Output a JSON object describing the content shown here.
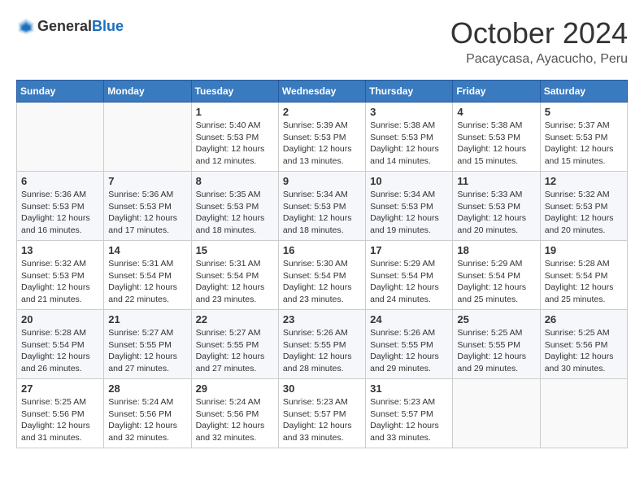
{
  "header": {
    "logo": {
      "general": "General",
      "blue": "Blue"
    },
    "month": "October 2024",
    "location": "Pacaycasa, Ayacucho, Peru"
  },
  "days_of_week": [
    "Sunday",
    "Monday",
    "Tuesday",
    "Wednesday",
    "Thursday",
    "Friday",
    "Saturday"
  ],
  "weeks": [
    [
      {
        "day": "",
        "info": ""
      },
      {
        "day": "",
        "info": ""
      },
      {
        "day": "1",
        "info": "Sunrise: 5:40 AM\nSunset: 5:53 PM\nDaylight: 12 hours and 12 minutes."
      },
      {
        "day": "2",
        "info": "Sunrise: 5:39 AM\nSunset: 5:53 PM\nDaylight: 12 hours and 13 minutes."
      },
      {
        "day": "3",
        "info": "Sunrise: 5:38 AM\nSunset: 5:53 PM\nDaylight: 12 hours and 14 minutes."
      },
      {
        "day": "4",
        "info": "Sunrise: 5:38 AM\nSunset: 5:53 PM\nDaylight: 12 hours and 15 minutes."
      },
      {
        "day": "5",
        "info": "Sunrise: 5:37 AM\nSunset: 5:53 PM\nDaylight: 12 hours and 15 minutes."
      }
    ],
    [
      {
        "day": "6",
        "info": "Sunrise: 5:36 AM\nSunset: 5:53 PM\nDaylight: 12 hours and 16 minutes."
      },
      {
        "day": "7",
        "info": "Sunrise: 5:36 AM\nSunset: 5:53 PM\nDaylight: 12 hours and 17 minutes."
      },
      {
        "day": "8",
        "info": "Sunrise: 5:35 AM\nSunset: 5:53 PM\nDaylight: 12 hours and 18 minutes."
      },
      {
        "day": "9",
        "info": "Sunrise: 5:34 AM\nSunset: 5:53 PM\nDaylight: 12 hours and 18 minutes."
      },
      {
        "day": "10",
        "info": "Sunrise: 5:34 AM\nSunset: 5:53 PM\nDaylight: 12 hours and 19 minutes."
      },
      {
        "day": "11",
        "info": "Sunrise: 5:33 AM\nSunset: 5:53 PM\nDaylight: 12 hours and 20 minutes."
      },
      {
        "day": "12",
        "info": "Sunrise: 5:32 AM\nSunset: 5:53 PM\nDaylight: 12 hours and 20 minutes."
      }
    ],
    [
      {
        "day": "13",
        "info": "Sunrise: 5:32 AM\nSunset: 5:53 PM\nDaylight: 12 hours and 21 minutes."
      },
      {
        "day": "14",
        "info": "Sunrise: 5:31 AM\nSunset: 5:54 PM\nDaylight: 12 hours and 22 minutes."
      },
      {
        "day": "15",
        "info": "Sunrise: 5:31 AM\nSunset: 5:54 PM\nDaylight: 12 hours and 23 minutes."
      },
      {
        "day": "16",
        "info": "Sunrise: 5:30 AM\nSunset: 5:54 PM\nDaylight: 12 hours and 23 minutes."
      },
      {
        "day": "17",
        "info": "Sunrise: 5:29 AM\nSunset: 5:54 PM\nDaylight: 12 hours and 24 minutes."
      },
      {
        "day": "18",
        "info": "Sunrise: 5:29 AM\nSunset: 5:54 PM\nDaylight: 12 hours and 25 minutes."
      },
      {
        "day": "19",
        "info": "Sunrise: 5:28 AM\nSunset: 5:54 PM\nDaylight: 12 hours and 25 minutes."
      }
    ],
    [
      {
        "day": "20",
        "info": "Sunrise: 5:28 AM\nSunset: 5:54 PM\nDaylight: 12 hours and 26 minutes."
      },
      {
        "day": "21",
        "info": "Sunrise: 5:27 AM\nSunset: 5:55 PM\nDaylight: 12 hours and 27 minutes."
      },
      {
        "day": "22",
        "info": "Sunrise: 5:27 AM\nSunset: 5:55 PM\nDaylight: 12 hours and 27 minutes."
      },
      {
        "day": "23",
        "info": "Sunrise: 5:26 AM\nSunset: 5:55 PM\nDaylight: 12 hours and 28 minutes."
      },
      {
        "day": "24",
        "info": "Sunrise: 5:26 AM\nSunset: 5:55 PM\nDaylight: 12 hours and 29 minutes."
      },
      {
        "day": "25",
        "info": "Sunrise: 5:25 AM\nSunset: 5:55 PM\nDaylight: 12 hours and 29 minutes."
      },
      {
        "day": "26",
        "info": "Sunrise: 5:25 AM\nSunset: 5:56 PM\nDaylight: 12 hours and 30 minutes."
      }
    ],
    [
      {
        "day": "27",
        "info": "Sunrise: 5:25 AM\nSunset: 5:56 PM\nDaylight: 12 hours and 31 minutes."
      },
      {
        "day": "28",
        "info": "Sunrise: 5:24 AM\nSunset: 5:56 PM\nDaylight: 12 hours and 32 minutes."
      },
      {
        "day": "29",
        "info": "Sunrise: 5:24 AM\nSunset: 5:56 PM\nDaylight: 12 hours and 32 minutes."
      },
      {
        "day": "30",
        "info": "Sunrise: 5:23 AM\nSunset: 5:57 PM\nDaylight: 12 hours and 33 minutes."
      },
      {
        "day": "31",
        "info": "Sunrise: 5:23 AM\nSunset: 5:57 PM\nDaylight: 12 hours and 33 minutes."
      },
      {
        "day": "",
        "info": ""
      },
      {
        "day": "",
        "info": ""
      }
    ]
  ]
}
